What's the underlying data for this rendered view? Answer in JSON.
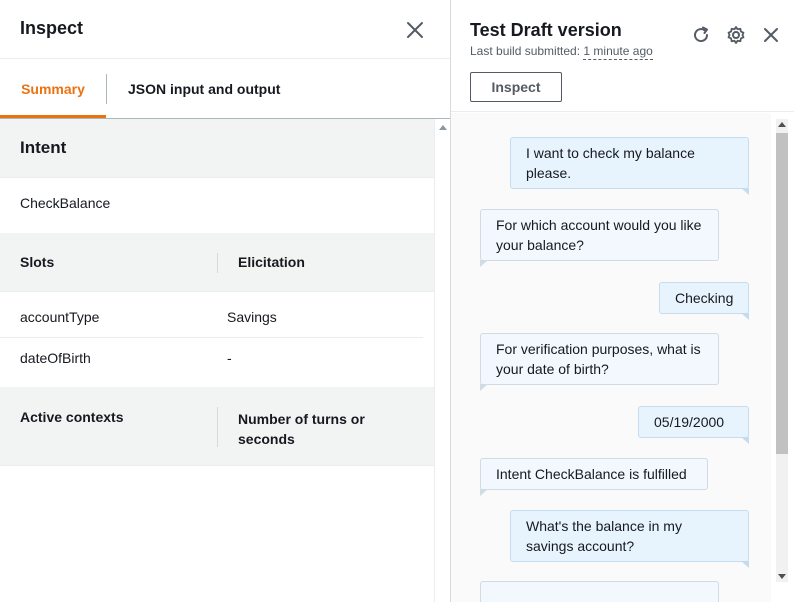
{
  "inspect_panel": {
    "title": "Inspect",
    "close_icon": "close-icon",
    "tabs": [
      {
        "label": "Summary",
        "active": true
      },
      {
        "label": "JSON input and output",
        "active": false
      }
    ],
    "intent": {
      "heading": "Intent",
      "value": "CheckBalance"
    },
    "slots": {
      "columns": [
        "Slots",
        "Elicitation"
      ],
      "rows": [
        {
          "name": "accountType",
          "value": "Savings"
        },
        {
          "name": "dateOfBirth",
          "value": "-"
        }
      ]
    },
    "contexts": {
      "columns": [
        "Active contexts",
        "Number of turns or seconds"
      ]
    }
  },
  "test_panel": {
    "title": "Test Draft version",
    "build_label": "Last build submitted:",
    "build_time": "1 minute ago",
    "inspect_button": "Inspect",
    "icons": [
      "refresh-icon",
      "settings-icon",
      "close-icon"
    ]
  },
  "conversation": [
    {
      "from": "user",
      "text": "I want to check my balance please."
    },
    {
      "from": "bot",
      "text": "For which account would you like your balance?"
    },
    {
      "from": "user",
      "text": "Checking"
    },
    {
      "from": "bot",
      "text": "For verification purposes, what is your date of birth?"
    },
    {
      "from": "user",
      "text": "05/19/2000"
    },
    {
      "from": "bot",
      "text": "Intent CheckBalance is fulfilled"
    },
    {
      "from": "user",
      "text": "What's the balance in my savings account?"
    }
  ],
  "colors": {
    "accent": "#ec7211",
    "text": "#16191f",
    "muted": "#545b64",
    "section_bg": "#f2f3f3",
    "user_bubble": "#e8f4fd",
    "bot_bubble": "#f2f8fd"
  }
}
